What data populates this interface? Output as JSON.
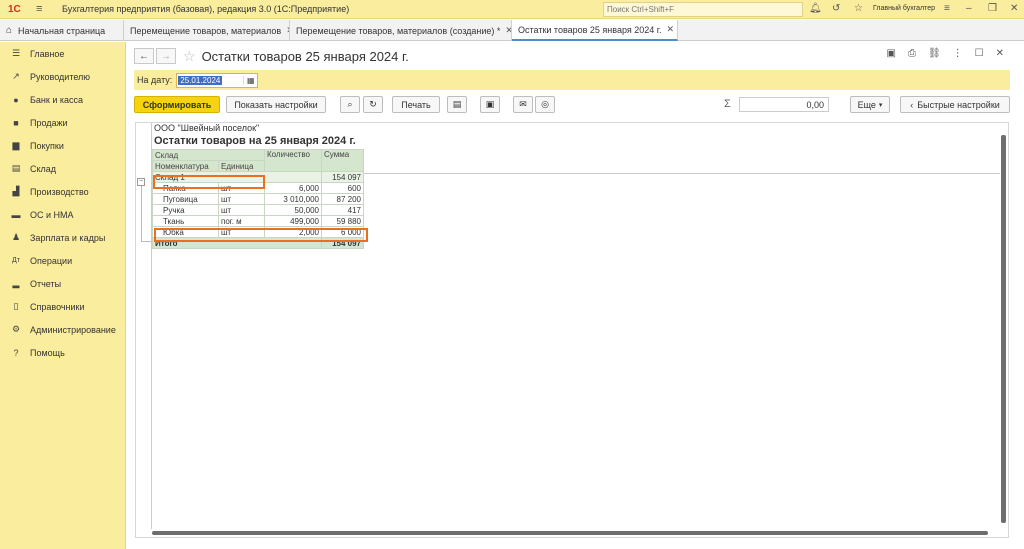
{
  "titlebar": {
    "logo": "1С",
    "title": "Бухгалтерия предприятия (базовая), редакция 3.0  (1С:Предприятие)",
    "search_placeholder": "Поиск Ctrl+Shift+F",
    "user": "Главный бухгалтер"
  },
  "tabs": {
    "home": "Начальная страница",
    "t1": "Перемещение товаров, материалов",
    "t2": "Перемещение товаров, материалов (создание) *",
    "t3": "Остатки товаров 25 января 2024 г."
  },
  "sidebar": {
    "items": [
      {
        "label": "Главное",
        "icon": "menu-icon"
      },
      {
        "label": "Руководителю",
        "icon": "trend-icon"
      },
      {
        "label": "Банк и касса",
        "icon": "coin-icon"
      },
      {
        "label": "Продажи",
        "icon": "bag-icon"
      },
      {
        "label": "Покупки",
        "icon": "cart-icon"
      },
      {
        "label": "Склад",
        "icon": "warehouse-icon"
      },
      {
        "label": "Производство",
        "icon": "factory-icon"
      },
      {
        "label": "ОС и НМА",
        "icon": "truck-icon"
      },
      {
        "label": "Зарплата и кадры",
        "icon": "person-icon"
      },
      {
        "label": "Операции",
        "icon": "operations-icon"
      },
      {
        "label": "Отчеты",
        "icon": "chart-icon"
      },
      {
        "label": "Справочники",
        "icon": "book-icon"
      },
      {
        "label": "Администрирование",
        "icon": "gear-icon"
      },
      {
        "label": "Помощь",
        "icon": "question-icon"
      }
    ]
  },
  "form": {
    "title": "Остатки товаров 25 января 2024 г.",
    "date_label": "На дату:",
    "date_value": "25.01.2024"
  },
  "toolbar": {
    "generate": "Сформировать",
    "show_settings": "Показать настройки",
    "print": "Печать",
    "sum_value": "0,00",
    "more": "Еще",
    "quick_settings": "Быстрые настройки"
  },
  "report": {
    "org": "ООО \"Швейный поселок\"",
    "title": "Остатки товаров на 25 января 2024 г.",
    "headers": {
      "warehouse": "Склад",
      "nomenclature": "Номенклатура",
      "unit": "Единица",
      "quantity": "Количество",
      "sum": "Сумма"
    },
    "group": {
      "name": "Склад 1",
      "sum": "154 097"
    },
    "rows": [
      {
        "name": "Папка",
        "unit": "шт",
        "qty": "6,000",
        "sum": "600"
      },
      {
        "name": "Пуговица",
        "unit": "шт",
        "qty": "3 010,000",
        "sum": "87 200"
      },
      {
        "name": "Ручка",
        "unit": "шт",
        "qty": "50,000",
        "sum": "417"
      },
      {
        "name": "Ткань",
        "unit": "пог. м",
        "qty": "499,000",
        "sum": "59 880"
      },
      {
        "name": "Юбка",
        "unit": "шт",
        "qty": "2,000",
        "sum": "6 000"
      }
    ],
    "total_label": "Итого",
    "total_sum": "154 097"
  }
}
